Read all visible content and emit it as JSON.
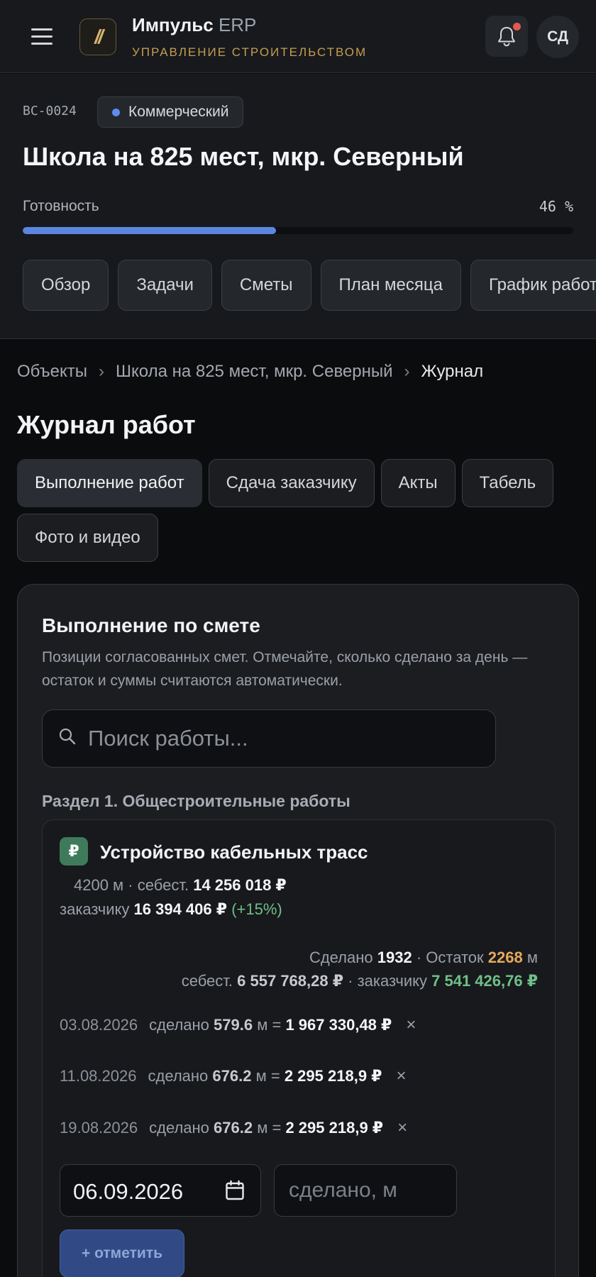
{
  "topbar": {
    "brand_name": "Импульс",
    "brand_suffix": "ERP",
    "brand_subtitle": "УПРАВЛЕНИЕ СТРОИТЕЛЬСТВОМ",
    "logo_text": "//",
    "avatar_initials": "СД",
    "notification_dot_color": "#e5584d"
  },
  "project": {
    "code": "BC-0024",
    "type": "Коммерческий",
    "type_color": "#5c8cf0",
    "title": "Школа на 825 мест, мкр. Северный",
    "readiness_label": "Готовность",
    "readiness_value": "46 %",
    "readiness_percent": 46,
    "tabs": [
      "Обзор",
      "Задачи",
      "Сметы",
      "План месяца",
      "График работ"
    ]
  },
  "breadcrumb": {
    "items": [
      "Объекты",
      "Школа на 825 мест, мкр. Северный",
      "Журнал"
    ],
    "separator": "›"
  },
  "page": {
    "title": "Журнал работ",
    "tabs": [
      "Выполнение работ",
      "Сдача заказчику",
      "Акты",
      "Табель",
      "Фото и видео"
    ],
    "active_tab": "Выполнение работ"
  },
  "card": {
    "title": "Выполнение по смете",
    "description": "Позиции согласованных смет. Отмечайте, сколько сделано за день — остаток и суммы считаются автоматически.",
    "search_placeholder": "Поиск работы...",
    "section_title": "Раздел 1. Общестроительные работы",
    "item": {
      "badge": "₽",
      "name": "Устройство кабельных трасс",
      "quantity": "4200 м",
      "cost_label": "себест.",
      "cost_value": "14 256 018 ₽",
      "customer_label": "заказчику",
      "customer_value": "16 394 406 ₽",
      "markup": "(+15%)",
      "done_label": "Сделано",
      "done_value": "1932",
      "remaining_label": "Остаток",
      "remaining_value": "2268",
      "unit": "м",
      "done_cost_label": "себест.",
      "done_cost_value": "6 557 768,28 ₽",
      "done_customer_label": "заказчику",
      "done_customer_value": "7 541 426,76 ₽",
      "entries": [
        {
          "date": "03.08.2026",
          "label": "сделано",
          "qty": "579.6",
          "unit": "м =",
          "sum": "1 967 330,48 ₽"
        },
        {
          "date": "11.08.2026",
          "label": "сделано",
          "qty": "676.2",
          "unit": "м =",
          "sum": "2 295 218,9 ₽"
        },
        {
          "date": "19.08.2026",
          "label": "сделано",
          "qty": "676.2",
          "unit": "м =",
          "sum": "2 295 218,9 ₽"
        }
      ],
      "delete_glyph": "×",
      "date_value": "06.09.2026",
      "done_placeholder": "сделано, м",
      "mark_button": "+ отметить"
    }
  }
}
